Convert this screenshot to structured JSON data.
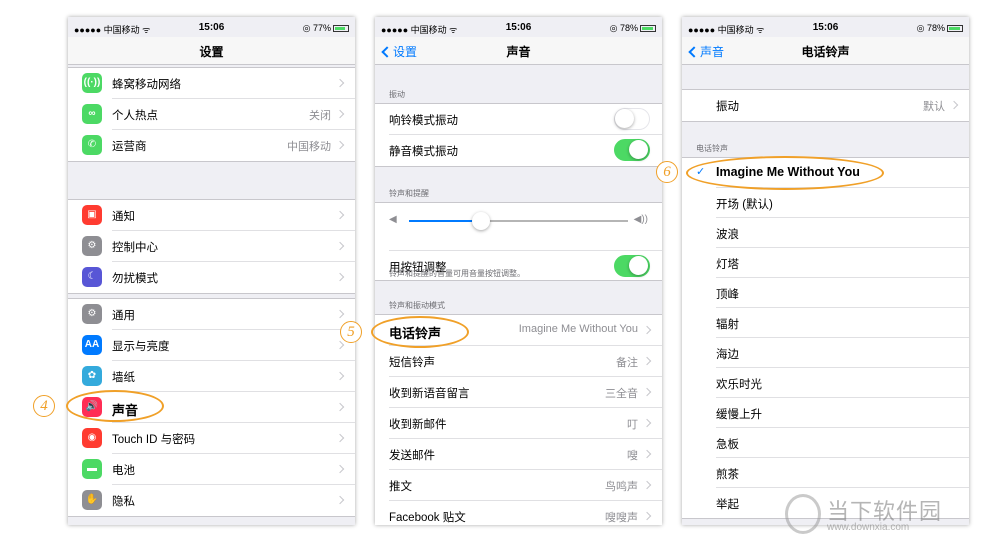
{
  "status": {
    "carrier": "●●●●● 中国移动 ᯤ",
    "time": "15:06",
    "battery_1": "◎ 77%",
    "battery_2": "◎ 78%",
    "battery_3": "◎ 78%"
  },
  "screen1": {
    "title": "设置",
    "group1": [
      {
        "label": "蜂窝移动网络",
        "value": "",
        "icon": "antenna-icon",
        "glyph": "((·))",
        "color": "#4cd964"
      },
      {
        "label": "个人热点",
        "value": "关闭",
        "icon": "hotspot-icon",
        "glyph": "∞",
        "color": "#4cd964"
      },
      {
        "label": "运营商",
        "value": "中国移动",
        "icon": "phone-icon",
        "glyph": "✆",
        "color": "#4cd964"
      }
    ],
    "group2": [
      {
        "label": "通知",
        "value": "",
        "icon": "notification-icon",
        "glyph": "▣",
        "color": "#ff3b30"
      },
      {
        "label": "控制中心",
        "value": "",
        "icon": "control-center-icon",
        "glyph": "⚙",
        "color": "#8e8e93"
      },
      {
        "label": "勿扰模式",
        "value": "",
        "icon": "moon-icon",
        "glyph": "☾",
        "color": "#5856d6"
      }
    ],
    "group3": [
      {
        "label": "通用",
        "value": "",
        "icon": "gear-icon",
        "glyph": "⚙",
        "color": "#8e8e93"
      },
      {
        "label": "显示与亮度",
        "value": "",
        "icon": "display-icon",
        "glyph": "AA",
        "color": "#007aff"
      },
      {
        "label": "墙纸",
        "value": "",
        "icon": "wallpaper-icon",
        "glyph": "✿",
        "color": "#34aadc"
      },
      {
        "label": "声音",
        "value": "",
        "icon": "sound-icon",
        "glyph": "🔊",
        "color": "#ff2d55"
      },
      {
        "label": "Touch ID 与密码",
        "value": "",
        "icon": "fingerprint-icon",
        "glyph": "◉",
        "color": "#ff3b30"
      },
      {
        "label": "电池",
        "value": "",
        "icon": "battery-icon",
        "glyph": "▬",
        "color": "#4cd964"
      },
      {
        "label": "隐私",
        "value": "",
        "icon": "hand-icon",
        "glyph": "✋",
        "color": "#8e8e93"
      }
    ],
    "step": "4"
  },
  "screen2": {
    "back": "设置",
    "title": "声音",
    "sect_vibrate": "振动",
    "vibrate_rows": [
      {
        "label": "响铃模式振动",
        "on": false
      },
      {
        "label": "静音模式振动",
        "on": true
      }
    ],
    "sect_ringer": "铃声和提醒",
    "ringer_level": 0.33,
    "button_adjust": {
      "label": "用按钮调整",
      "on": true
    },
    "footnote": "铃声和提醒的音量可用音量按钮调整。",
    "sect_patterns": "铃声和振动模式",
    "pattern_rows": [
      {
        "label": "电话铃声",
        "value": "Imagine Me Without You"
      },
      {
        "label": "短信铃声",
        "value": "备注"
      },
      {
        "label": "收到新语音留言",
        "value": "三全音"
      },
      {
        "label": "收到新邮件",
        "value": "叮"
      },
      {
        "label": "发送邮件",
        "value": "嗖"
      },
      {
        "label": "推文",
        "value": "鸟鸣声"
      },
      {
        "label": "Facebook 贴文",
        "value": "嗖嗖声"
      }
    ],
    "step": "5"
  },
  "screen3": {
    "back": "声音",
    "title": "电话铃声",
    "vibrate": {
      "label": "振动",
      "value": "默认"
    },
    "sect_ringtones": "电话铃声",
    "ringtones": [
      "Imagine Me Without You",
      "开场 (默认)",
      "波浪",
      "灯塔",
      "顶峰",
      "辐射",
      "海边",
      "欢乐时光",
      "缓慢上升",
      "急板",
      "煎茶",
      "举起"
    ],
    "selected_index": 0,
    "step": "6"
  },
  "watermark": {
    "big": "当下软件园",
    "small": "www.downxia.com"
  }
}
